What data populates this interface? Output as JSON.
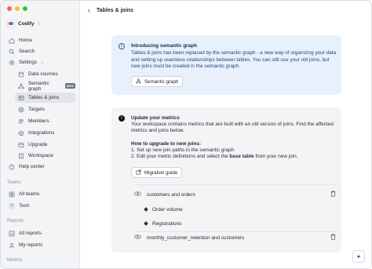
{
  "app": {
    "workspace_name": "Codify",
    "traffic_colors": [
      "#ff5f57",
      "#febc2e",
      "#28c840"
    ]
  },
  "sidebar": {
    "items": [
      {
        "label": "Home",
        "icon": "home-icon"
      },
      {
        "label": "Search",
        "icon": "search-icon"
      },
      {
        "label": "Settings",
        "icon": "gear-icon"
      }
    ],
    "settings_items": [
      {
        "label": "Data sources",
        "icon": "database-icon"
      },
      {
        "label": "Semantic graph",
        "icon": "graph-icon",
        "badge": "NEW"
      },
      {
        "label": "Tables & joins",
        "icon": "table-icon",
        "active": true
      },
      {
        "label": "Targets",
        "icon": "target-icon"
      },
      {
        "label": "Members",
        "icon": "members-icon"
      },
      {
        "label": "Integrations",
        "icon": "integrations-icon"
      },
      {
        "label": "Upgrade",
        "icon": "upgrade-icon"
      },
      {
        "label": "Workspace",
        "icon": "workspace-icon"
      }
    ],
    "help_center": "Help center",
    "teams_label": "Teams",
    "teams": [
      {
        "label": "All teams",
        "icon": "teams-icon"
      },
      {
        "label": "Tech",
        "tag": "T"
      }
    ],
    "reports_label": "Reports",
    "reports": [
      {
        "label": "All reports",
        "icon": "reports-icon"
      },
      {
        "label": "My reports",
        "icon": "my-reports-icon"
      }
    ],
    "metrics_label": "Metrics"
  },
  "header": {
    "title": "Tables & joins"
  },
  "info": {
    "title": "Introducing semantic graph",
    "text": "Tables & joins has been replaced by the semantic graph - a new way of organizing your data and setting up seamless relationships between tables. You can still use your old joins, but new joins must be created in the semantic graph.",
    "button": "Semantic graph"
  },
  "metrics_notice": {
    "title": "Update your metrics",
    "text": "Your workspace contains metrics that are built with an old version of joins. Find the affected metrics and joins below.",
    "howto": "How to upgrade to new joins:",
    "step1": "1.  Set up new join paths in the semantic graph",
    "step2_prefix": "2.  Edit your metric definitions and select the ",
    "step2_bold": "base table",
    "step2_suffix": " from your new join.",
    "button": "Migration guide",
    "joins": [
      {
        "name": "customers and orders",
        "metrics": [
          "Order volume",
          "Registrations"
        ]
      },
      {
        "name": "monthly_customer_retention and customers",
        "metrics": []
      }
    ]
  }
}
